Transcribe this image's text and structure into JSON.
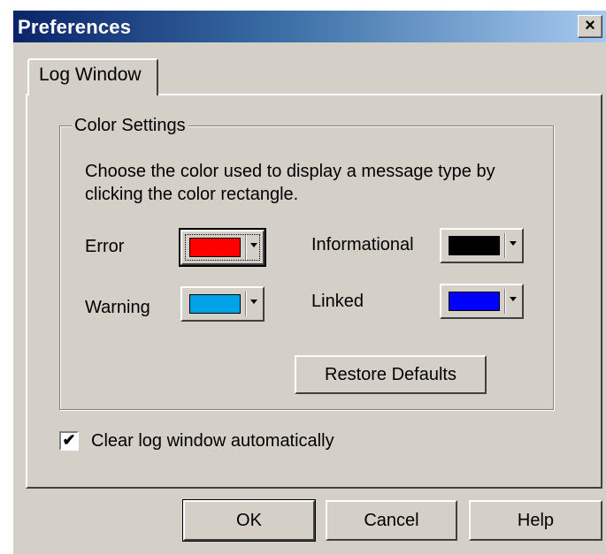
{
  "window": {
    "title": "Preferences",
    "close_glyph": "×"
  },
  "tabs": [
    {
      "label": "Log Window",
      "active": true
    }
  ],
  "color_settings": {
    "group_label": "Color Settings",
    "description": "Choose the color used to display a message type by clicking the color rectangle.",
    "items": [
      {
        "label": "Error",
        "color": "#ff0000"
      },
      {
        "label": "Informational",
        "color": "#000000"
      },
      {
        "label": "Warning",
        "color": "#00a2e8"
      },
      {
        "label": "Linked",
        "color": "#0000ff"
      }
    ],
    "restore_label": "Restore Defaults"
  },
  "clear_log": {
    "label": "Clear log window automatically",
    "checked": true,
    "check_glyph": "✔"
  },
  "buttons": {
    "ok": "OK",
    "cancel": "Cancel",
    "help": "Help"
  }
}
